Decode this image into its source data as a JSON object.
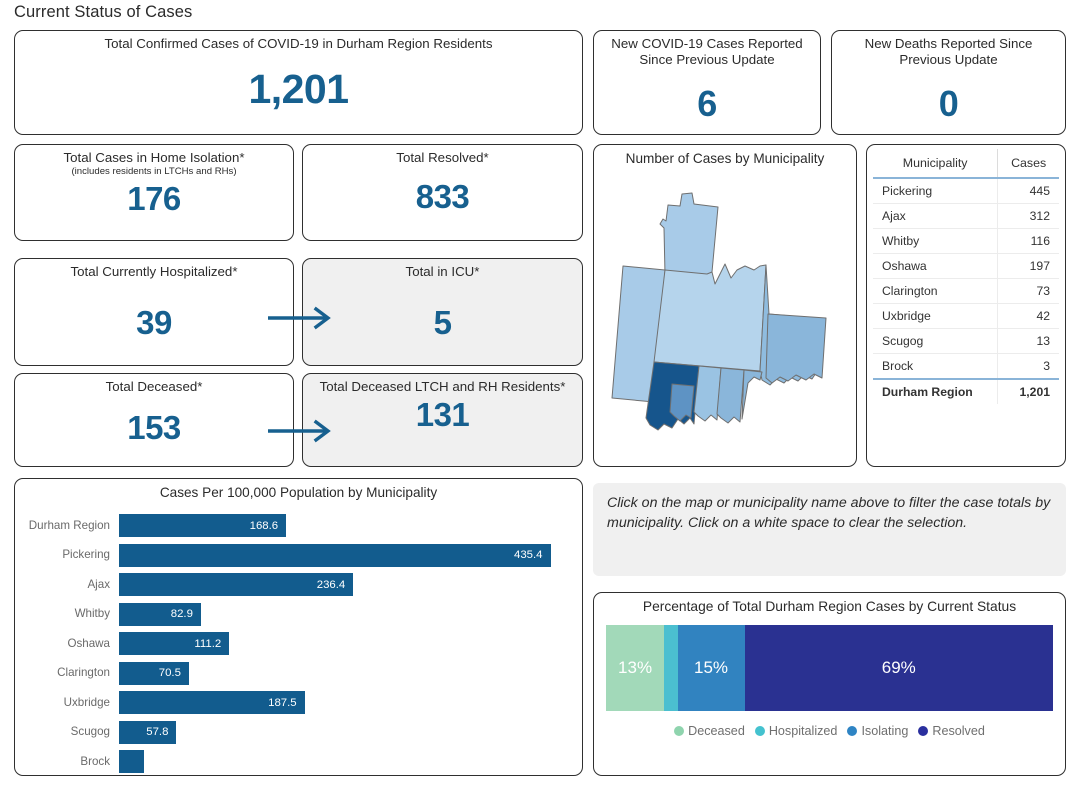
{
  "page": {
    "title": "Current Status of Cases"
  },
  "summary_cards": {
    "total_confirmed": {
      "title": "Total Confirmed Cases of COVID-19 in Durham Region Residents",
      "value": "1,201"
    },
    "new_cases": {
      "title": "New COVID-19 Cases Reported Since Previous Update",
      "value": "6"
    },
    "new_deaths": {
      "title": "New Deaths Reported Since Previous Update",
      "value": "0"
    },
    "home_isolation": {
      "title": "Total Cases in Home Isolation*",
      "subtitle": "(includes residents in LTCHs and RHs)",
      "value": "176"
    },
    "resolved": {
      "title": "Total Resolved*",
      "value": "833"
    },
    "hospitalized": {
      "title": "Total Currently Hospitalized*",
      "value": "39"
    },
    "icu": {
      "title": "Total in ICU*",
      "value": "5"
    },
    "deceased": {
      "title": "Total Deceased*",
      "value": "153"
    },
    "deceased_ltch": {
      "title": "Total Deceased LTCH and RH Residents*",
      "value": "131"
    }
  },
  "map": {
    "title": "Number of Cases by Municipality",
    "regions": [
      {
        "name": "Brock",
        "fill": "#a8cbe8"
      },
      {
        "name": "Uxbridge",
        "fill": "#a8cbe8"
      },
      {
        "name": "Scugog",
        "fill": "#b5d4ec"
      },
      {
        "name": "Clarington",
        "fill": "#8fbcdf"
      },
      {
        "name": "Pickering",
        "fill": "#16558c"
      },
      {
        "name": "Ajax",
        "fill": "#5e93c4"
      },
      {
        "name": "Whitby",
        "fill": "#9ac3e3"
      },
      {
        "name": "Oshawa",
        "fill": "#8ab6da"
      }
    ]
  },
  "municipality_table": {
    "headers": [
      "Municipality",
      "Cases"
    ],
    "rows": [
      {
        "name": "Pickering",
        "cases": "445"
      },
      {
        "name": "Ajax",
        "cases": "312"
      },
      {
        "name": "Whitby",
        "cases": "116"
      },
      {
        "name": "Oshawa",
        "cases": "197"
      },
      {
        "name": "Clarington",
        "cases": "73"
      },
      {
        "name": "Uxbridge",
        "cases": "42"
      },
      {
        "name": "Scugog",
        "cases": "13"
      },
      {
        "name": "Brock",
        "cases": "3"
      }
    ],
    "total": {
      "name": "Durham Region",
      "cases": "1,201"
    }
  },
  "hint": {
    "text": "Click on the map or municipality name above to filter the case totals by municipality. Click on a white space to clear the selection."
  },
  "chart_data": [
    {
      "type": "bar",
      "orientation": "horizontal",
      "title": "Cases Per 100,000 Population by Municipality",
      "xlabel": "",
      "ylabel": "",
      "xlim": [
        0,
        470
      ],
      "grid": false,
      "bar_color": "#125c8e",
      "label_color": "#ffffff",
      "categories": [
        "Durham Region",
        "Pickering",
        "Ajax",
        "Whitby",
        "Oshawa",
        "Clarington",
        "Uxbridge",
        "Scugog",
        "Brock"
      ],
      "values": [
        168.6,
        435.4,
        236.4,
        82.9,
        111.2,
        70.5,
        187.5,
        57.8,
        25.9
      ],
      "value_labels": [
        "168.6",
        "435.4",
        "236.4",
        "82.9",
        "111.2",
        "70.5",
        "187.5",
        "57.8",
        ""
      ]
    },
    {
      "type": "bar",
      "subtype": "stacked-100",
      "orientation": "horizontal",
      "title": "Percentage of Total Durham Region Cases by Current Status",
      "categories": [
        "Durham Region"
      ],
      "legend_position": "bottom",
      "series": [
        {
          "name": "Deceased",
          "values": [
            13
          ],
          "label": "13%",
          "color": "#a2d9b9"
        },
        {
          "name": "Hospitalized",
          "values": [
            3
          ],
          "label": "",
          "color": "#4bbfd0"
        },
        {
          "name": "Isolating",
          "values": [
            15
          ],
          "label": "15%",
          "color": "#3183c0"
        },
        {
          "name": "Resolved",
          "values": [
            69
          ],
          "label": "69%",
          "color": "#2a3191"
        }
      ]
    }
  ],
  "colors": {
    "accent_blue": "#17608f",
    "bar_blue": "#125c8e",
    "card_border": "#2f2f2f",
    "grey_card": "#f0f0f0"
  }
}
